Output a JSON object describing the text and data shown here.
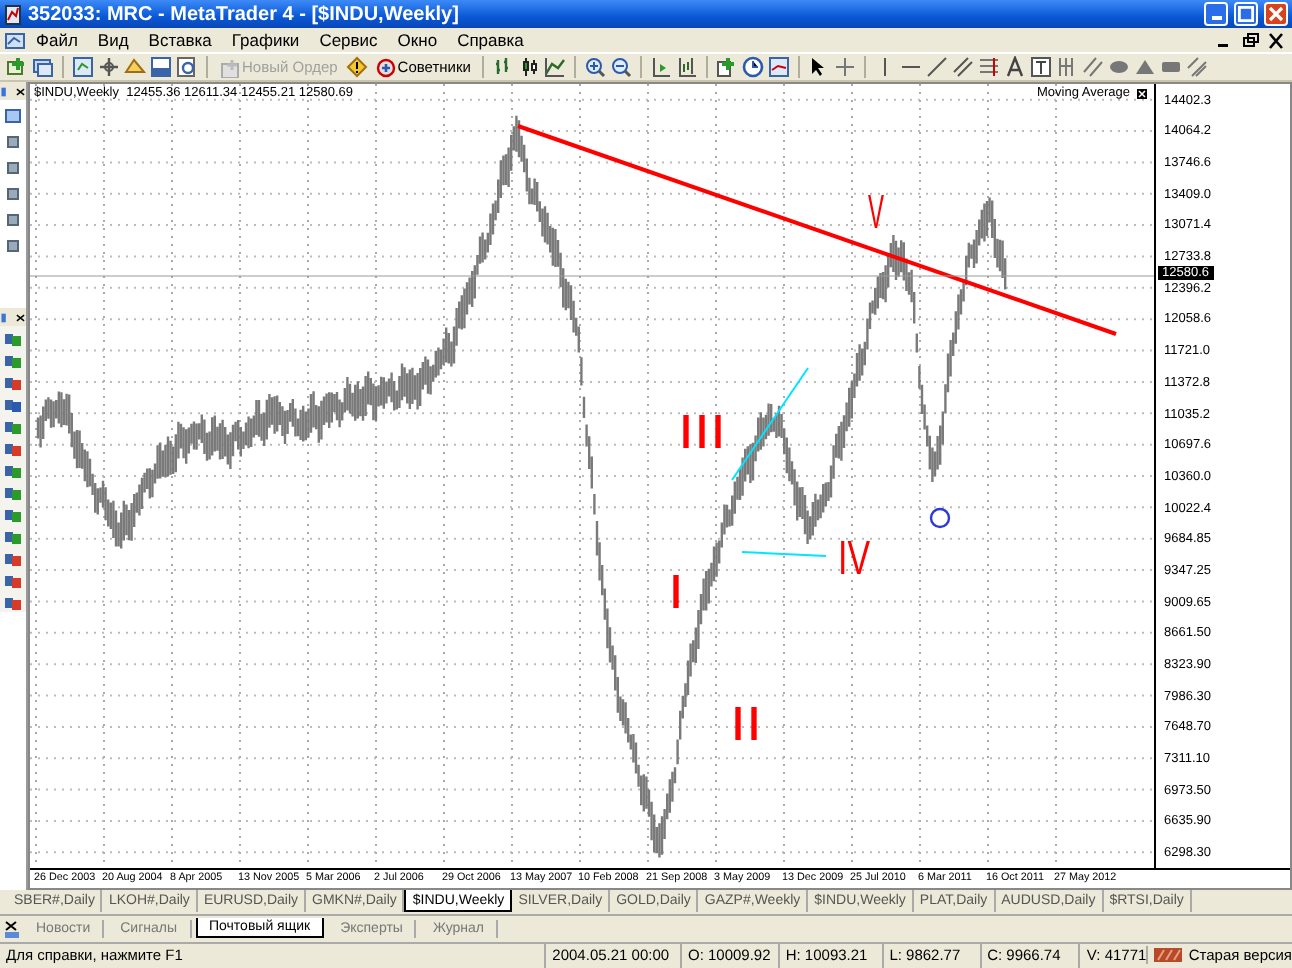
{
  "window": {
    "title": "352033: MRC - MetaTrader 4 - [$INDU,Weekly]"
  },
  "menu": [
    "Файл",
    "Вид",
    "Вставка",
    "Графики",
    "Сервис",
    "Окно",
    "Справка"
  ],
  "toolbar": {
    "buttons": [
      {
        "label": "Новый Ордер",
        "disabled": true
      },
      {
        "label": "Советники",
        "disabled": false
      }
    ]
  },
  "chart": {
    "header": "$INDU,Weekly  12455.36 12611.34 12455.21 12580.69",
    "indicator": "Moving Average",
    "price_axis": [
      "14402.3",
      "14064.2",
      "13746.6",
      "13409.0",
      "13071.4",
      "12733.8",
      "12396.2",
      "12058.6",
      "11721.0",
      "11372.8",
      "11035.2",
      "10697.6",
      "10360.0",
      "10022.4",
      "9684.85",
      "9347.25",
      "9009.65",
      "8661.50",
      "8323.90",
      "7986.30",
      "7648.70",
      "7311.10",
      "6973.50",
      "6635.90",
      "6298.30"
    ],
    "current_price": "12580.6",
    "date_axis": [
      "26 Dec 2003",
      "20 Aug 2004",
      "8 Apr 2005",
      "13 Nov 2005",
      "5 Mar 2006",
      "2 Jul 2006",
      "29 Oct 2006",
      "13 May 2007",
      "10 Feb 2008",
      "21 Sep 2008",
      "3 May 2009",
      "13 Dec 2009",
      "25 Jul 2010",
      "6 Mar 2011",
      "16 Oct 2011",
      "27 May 2012"
    ],
    "annotations": [
      {
        "text": "V",
        "color": "#ff0000"
      },
      {
        "text": "III",
        "color": "#ff0000"
      },
      {
        "text": "IV",
        "color": "#ff0000"
      },
      {
        "text": "I",
        "color": "#ff0000"
      },
      {
        "text": "II",
        "color": "#ff0000"
      }
    ]
  },
  "chart_tabs": [
    {
      "label": "SBER#,Daily",
      "selected": false
    },
    {
      "label": "LKOH#,Daily",
      "selected": false
    },
    {
      "label": "EURUSD,Daily",
      "selected": false
    },
    {
      "label": "GMKN#,Daily",
      "selected": false
    },
    {
      "label": "$INDU,Weekly",
      "selected": true
    },
    {
      "label": "SILVER,Daily",
      "selected": false
    },
    {
      "label": "GOLD,Daily",
      "selected": false
    },
    {
      "label": "GAZP#,Weekly",
      "selected": false
    },
    {
      "label": "$INDU,Weekly",
      "selected": false
    },
    {
      "label": "PLAT,Daily",
      "selected": false
    },
    {
      "label": "AUDUSD,Daily",
      "selected": false
    },
    {
      "label": "$RTSI,Daily",
      "selected": false
    }
  ],
  "terminal_tabs": [
    {
      "label": "Новости",
      "selected": false
    },
    {
      "label": "Сигналы",
      "selected": false
    },
    {
      "label": "Почтовый ящик",
      "selected": true
    },
    {
      "label": "Эксперты",
      "selected": false
    },
    {
      "label": "Журнал",
      "selected": false
    }
  ],
  "status_bar": {
    "help": "Для справки, нажмите F1",
    "date": "2004.05.21 00:00",
    "open": "O: 10009.92",
    "high": "H: 10093.21",
    "low": "L: 9862.77",
    "close": "C: 9966.74",
    "volume": "V: 41771",
    "version": "Старая версия"
  }
}
